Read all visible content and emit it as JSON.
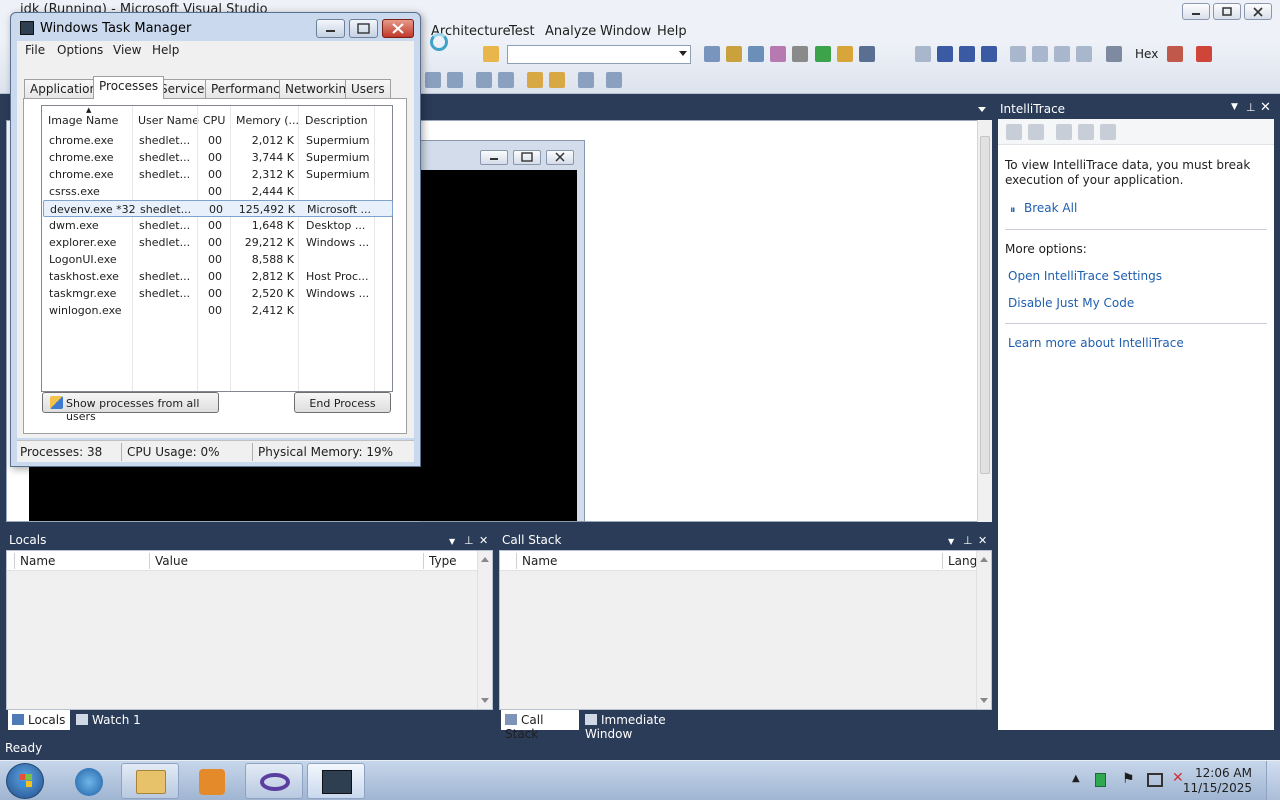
{
  "vs": {
    "window_title": "idk (Running) - Microsoft Visual Studio",
    "menu": [
      "Architecture",
      "Test",
      "Analyze",
      "Window",
      "Help"
    ],
    "toolbar": {
      "hex_label": "Hex"
    },
    "status": "Ready"
  },
  "task_manager": {
    "title": "Windows Task Manager",
    "menu": [
      "File",
      "Options",
      "View",
      "Help"
    ],
    "tabs": [
      "Applications",
      "Processes",
      "Services",
      "Performance",
      "Networking",
      "Users"
    ],
    "selected_tab": "Processes",
    "columns": [
      "Image Name",
      "User Name",
      "CPU",
      "Memory (...",
      "Description"
    ],
    "rows": [
      {
        "image": "chrome.exe",
        "user": "shedlet...",
        "cpu": "00",
        "mem": "2,012 K",
        "desc": "Supermium"
      },
      {
        "image": "chrome.exe",
        "user": "shedlet...",
        "cpu": "00",
        "mem": "3,744 K",
        "desc": "Supermium"
      },
      {
        "image": "chrome.exe",
        "user": "shedlet...",
        "cpu": "00",
        "mem": "2,312 K",
        "desc": "Supermium"
      },
      {
        "image": "csrss.exe",
        "user": "",
        "cpu": "00",
        "mem": "2,444 K",
        "desc": ""
      },
      {
        "image": "devenv.exe *32",
        "user": "shedlet...",
        "cpu": "00",
        "mem": "125,492 K",
        "desc": "Microsoft ..."
      },
      {
        "image": "dwm.exe",
        "user": "shedlet...",
        "cpu": "00",
        "mem": "1,648 K",
        "desc": "Desktop ..."
      },
      {
        "image": "explorer.exe",
        "user": "shedlet...",
        "cpu": "00",
        "mem": "29,212 K",
        "desc": "Windows ..."
      },
      {
        "image": "LogonUI.exe",
        "user": "",
        "cpu": "00",
        "mem": "8,588 K",
        "desc": ""
      },
      {
        "image": "taskhost.exe",
        "user": "shedlet...",
        "cpu": "00",
        "mem": "2,812 K",
        "desc": "Host Proc..."
      },
      {
        "image": "taskmgr.exe",
        "user": "shedlet...",
        "cpu": "00",
        "mem": "2,520 K",
        "desc": "Windows ..."
      },
      {
        "image": "winlogon.exe",
        "user": "",
        "cpu": "00",
        "mem": "2,412 K",
        "desc": ""
      }
    ],
    "show_all_label": "Show processes from all users",
    "end_process_label": "End Process",
    "status": {
      "processes": "Processes: 38",
      "cpu": "CPU Usage: 0%",
      "memory": "Physical Memory: 19%"
    }
  },
  "intellitrace": {
    "title": "IntelliTrace",
    "message": "To view IntelliTrace data, you must break execution of your application.",
    "break_all": "Break All",
    "more_options": "More options:",
    "open_settings": "Open IntelliTrace Settings",
    "disable_jmc": "Disable Just My Code",
    "learn_more": "Learn more about IntelliTrace"
  },
  "locals": {
    "title": "Locals",
    "columns": [
      "Name",
      "Value",
      "Type"
    ],
    "tabs": [
      "Locals",
      "Watch 1"
    ]
  },
  "callstack": {
    "title": "Call Stack",
    "columns": [
      "Name",
      "Lang"
    ],
    "tabs": [
      "Call Stack",
      "Immediate Window"
    ]
  },
  "taskbar": {
    "time": "12:06 AM",
    "date": "11/15/2025"
  }
}
